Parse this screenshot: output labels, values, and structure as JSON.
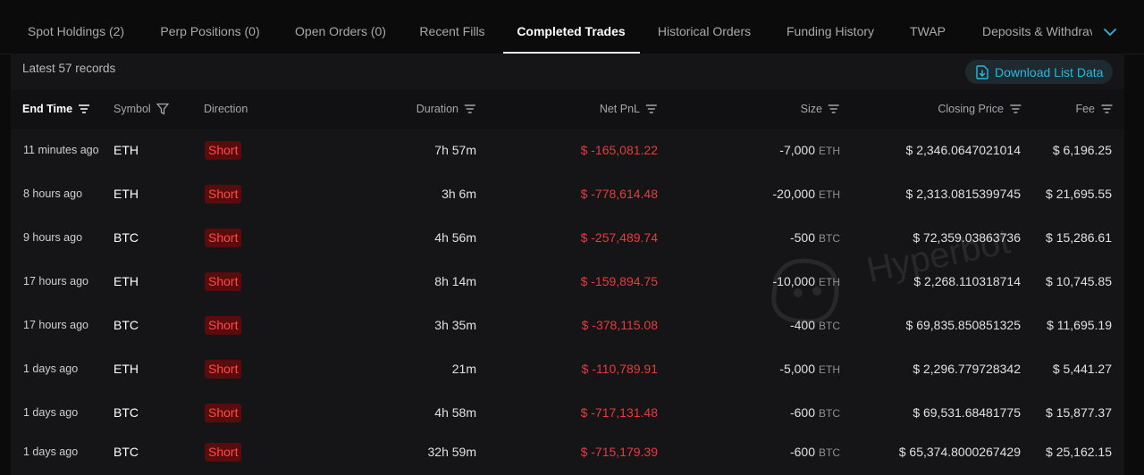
{
  "tabs": [
    {
      "label": "Spot Holdings (2)",
      "active": false
    },
    {
      "label": "Perp Positions (0)",
      "active": false
    },
    {
      "label": "Open Orders (0)",
      "active": false
    },
    {
      "label": "Recent Fills",
      "active": false
    },
    {
      "label": "Completed Trades",
      "active": true
    },
    {
      "label": "Historical Orders",
      "active": false
    },
    {
      "label": "Funding History",
      "active": false
    },
    {
      "label": "TWAP",
      "active": false
    },
    {
      "label": "Deposits & Withdrav",
      "active": false
    }
  ],
  "toolbar": {
    "records_label": "Latest 57 records",
    "download_label": "Download List Data"
  },
  "columns": {
    "end_time": "End Time",
    "symbol": "Symbol",
    "direction": "Direction",
    "duration": "Duration",
    "net_pnl": "Net PnL",
    "size": "Size",
    "closing_price": "Closing Price",
    "fee": "Fee"
  },
  "rows": [
    {
      "time": "11 minutes ago",
      "symbol": "ETH",
      "direction": "Short",
      "duration": "7h 57m",
      "pnl": "$ -165,081.22",
      "size": "-7,000",
      "size_unit": "ETH",
      "price": "$ 2,346.0647021014",
      "fee": "$ 6,196.25"
    },
    {
      "time": "8 hours ago",
      "symbol": "ETH",
      "direction": "Short",
      "duration": "3h 6m",
      "pnl": "$ -778,614.48",
      "size": "-20,000",
      "size_unit": "ETH",
      "price": "$ 2,313.0815399745",
      "fee": "$ 21,695.55"
    },
    {
      "time": "9 hours ago",
      "symbol": "BTC",
      "direction": "Short",
      "duration": "4h 56m",
      "pnl": "$ -257,489.74",
      "size": "-500",
      "size_unit": "BTC",
      "price": "$ 72,359.03863736",
      "fee": "$ 15,286.61"
    },
    {
      "time": "17 hours ago",
      "symbol": "ETH",
      "direction": "Short",
      "duration": "8h 14m",
      "pnl": "$ -159,894.75",
      "size": "-10,000",
      "size_unit": "ETH",
      "price": "$ 2,268.110318714",
      "fee": "$ 10,745.85"
    },
    {
      "time": "17 hours ago",
      "symbol": "BTC",
      "direction": "Short",
      "duration": "3h 35m",
      "pnl": "$ -378,115.08",
      "size": "-400",
      "size_unit": "BTC",
      "price": "$ 69,835.850851325",
      "fee": "$ 11,695.19"
    },
    {
      "time": "1 days ago",
      "symbol": "ETH",
      "direction": "Short",
      "duration": "21m",
      "pnl": "$ -110,789.91",
      "size": "-5,000",
      "size_unit": "ETH",
      "price": "$ 2,296.779728342",
      "fee": "$ 5,441.27"
    },
    {
      "time": "1 days ago",
      "symbol": "BTC",
      "direction": "Short",
      "duration": "4h 58m",
      "pnl": "$ -717,131.48",
      "size": "-600",
      "size_unit": "BTC",
      "price": "$ 69,531.68481775",
      "fee": "$ 15,877.37"
    },
    {
      "time": "1 days ago",
      "symbol": "BTC",
      "direction": "Short",
      "duration": "32h 59m",
      "pnl": "$ -715,179.39",
      "size": "-600",
      "size_unit": "BTC",
      "price": "$ 65,374.8000267429",
      "fee": "$ 25,162.15"
    }
  ],
  "watermark": "Hyperbot",
  "colors": {
    "background": "#0b0b0c",
    "panel": "#151517",
    "negative": "#e83a3a",
    "short_badge_bg": "#5a0b0b",
    "accent": "#27b8e0"
  },
  "icons": {
    "tabs_more": "chevron-down-icon",
    "download": "file-download-icon",
    "sort": "sort-lines-icon",
    "filter": "funnel-icon"
  }
}
